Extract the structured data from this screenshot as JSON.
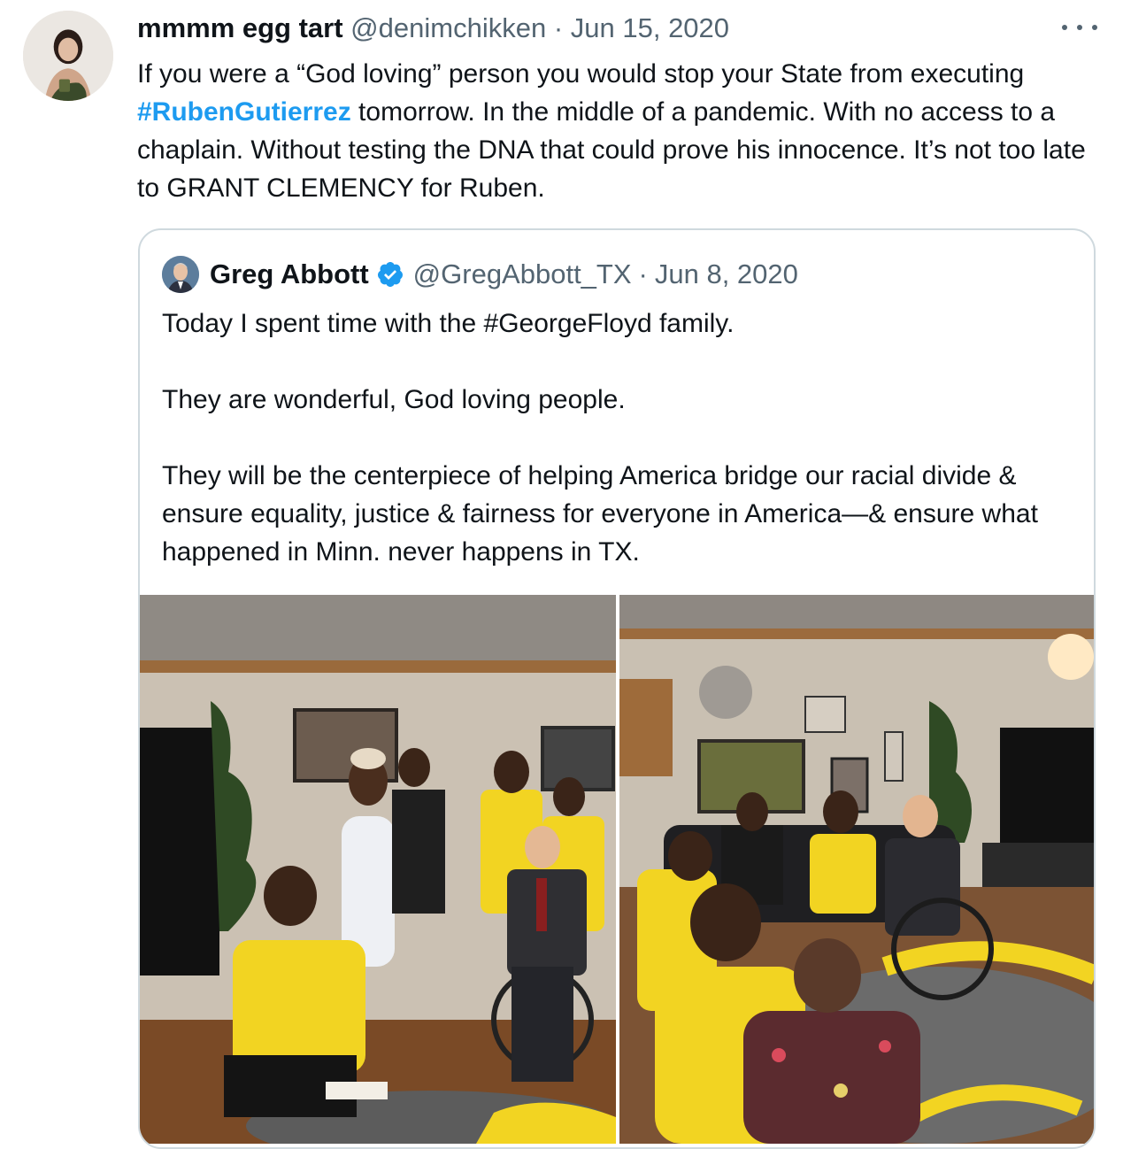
{
  "tweet": {
    "display_name": "mmmm egg tart",
    "handle": "@denimchikken",
    "separator": "·",
    "date": "Jun 15, 2020",
    "text_before_hashtag": "If you were a “God loving” person you would stop your State from executing ",
    "hashtag": "#RubenGutierrez",
    "text_after_hashtag": " tomorrow. In the middle of a pandemic. With no access to a chaplain. Without testing the DNA that could prove his innocence. It’s not too late to GRANT CLEMENCY for Ruben.",
    "more_icon": "more-horizontal-icon"
  },
  "quoted_tweet": {
    "display_name": "Greg Abbott",
    "verified_icon": "verified-badge-icon",
    "handle": "@GregAbbott_TX",
    "separator": "·",
    "date": "Jun 8, 2020",
    "paragraphs": [
      "Today I spent time with the #GeorgeFloyd family.",
      "They are wonderful, God loving people.",
      "They will be the centerpiece of helping America bridge our racial divide & ensure equality, justice & fairness for everyone in America—& ensure what happened in Minn. never happens in TX."
    ]
  },
  "colors": {
    "text": "#0f1419",
    "secondary": "#536471",
    "hashtag": "#1d9bf0",
    "border": "#cfd9de",
    "shirt_yellow": "#f2d422"
  }
}
